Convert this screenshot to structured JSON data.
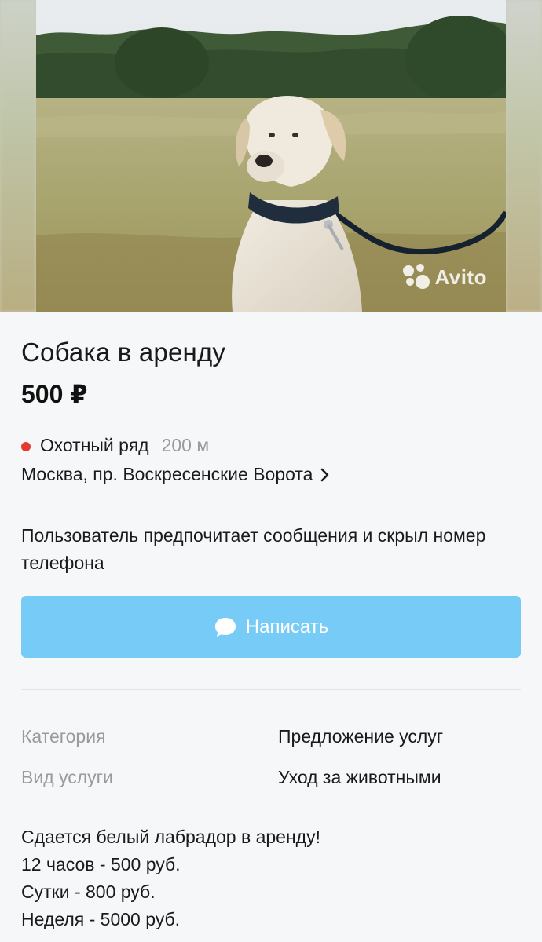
{
  "photo": {
    "watermark": "Avito"
  },
  "listing": {
    "title": "Собака в аренду",
    "price": "500 ₽"
  },
  "location": {
    "metro_station": "Охотный ряд",
    "metro_distance": "200 м",
    "address": "Москва, пр. Воскресенские Ворота",
    "metro_color": "#e33a32"
  },
  "contact": {
    "note": "Пользователь предпочитает сообщения и скрыл номер телефона",
    "write_button_label": "Написать",
    "button_color": "#77cbf7"
  },
  "params": [
    {
      "label": "Категория",
      "value": "Предложение услуг"
    },
    {
      "label": "Вид услуги",
      "value": "Уход за животными"
    }
  ],
  "description": {
    "lines": [
      "Сдается белый лабрадор в аренду!",
      "12 часов - 500 руб.",
      "Сутки - 800 руб.",
      "Неделя - 5000 руб."
    ]
  },
  "icons": {
    "chevron": "chevron-right-icon",
    "chat": "chat-bubble-icon",
    "avito_logo": "avito-logo-icon"
  }
}
